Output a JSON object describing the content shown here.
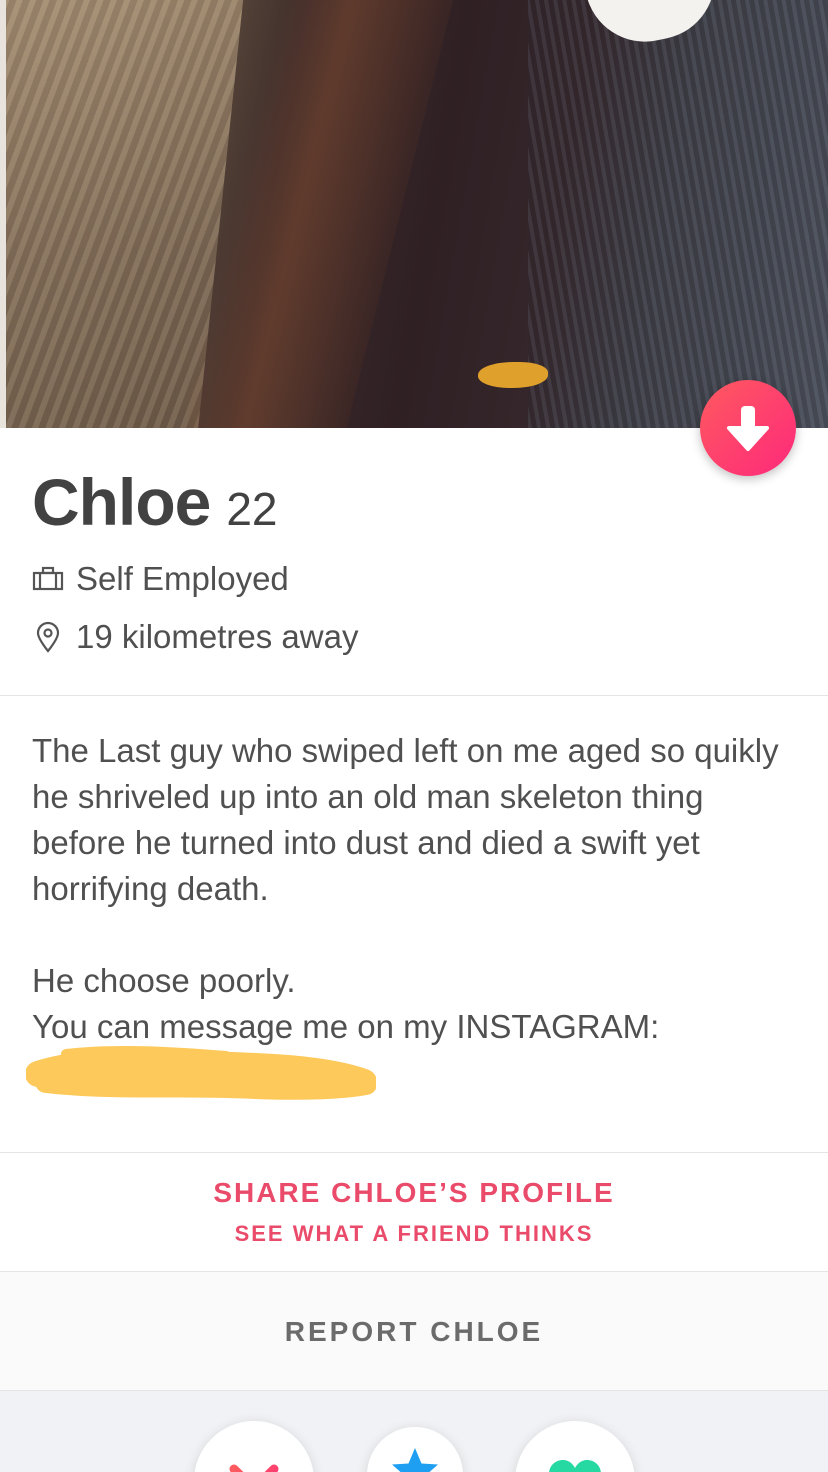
{
  "profile": {
    "name": "Chloe",
    "age": "22",
    "job": "Self Employed",
    "distance": "19 kilometres away"
  },
  "bio": {
    "paragraph1": "The Last guy who swiped left on me aged so quikly he shriveled up into an old man skeleton thing before he turned into dust and died a swift yet horrifying death.",
    "line2": "He choose poorly.",
    "line3": "You can message me on my INSTAGRAM:"
  },
  "actions": {
    "share_title": "SHARE CHLOE’S PROFILE",
    "share_subtitle": "SEE WHAT A FRIEND THINKS",
    "report": "REPORT CHLOE"
  },
  "icons": {
    "collapse": "arrow-down-icon",
    "job": "briefcase-icon",
    "distance": "location-pin-icon",
    "nope": "x-icon",
    "super_like": "star-icon",
    "like": "heart-icon"
  },
  "colors": {
    "accent": "#fd297b",
    "accent_gradient_start": "#ff5a5f",
    "share_text": "#ea4b6a",
    "redaction": "#fdc95a",
    "super_like": "#1e9ff2",
    "like": "#26d9a3"
  }
}
